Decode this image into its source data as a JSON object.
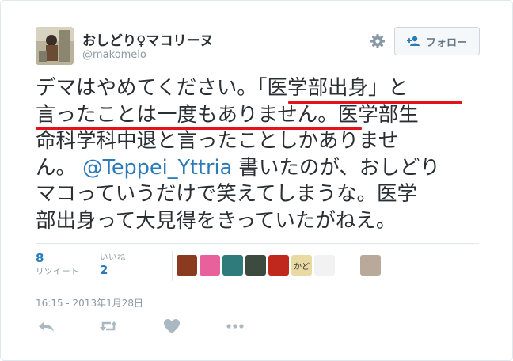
{
  "user": {
    "display_name": "おしどり♀マコリーヌ",
    "handle": "@makomelo"
  },
  "follow_button": {
    "label": "フォロー"
  },
  "tweet": {
    "lines": [
      [
        "デマはやめてください。",
        "「医学部出身」と"
      ],
      [
        "言ったことは一度もありません。",
        "医学部生"
      ],
      [
        "命科学科中退と言ったことしかありませ"
      ],
      [
        "ん。 ",
        "@Teppei_Yttria",
        " 書いたのが、おしどり"
      ],
      [
        "マコっていうだけで笑えてしまうな。医学"
      ],
      [
        "部出身って大見得をきっていたがねえ。"
      ]
    ]
  },
  "stats": {
    "retweets": {
      "count": "8",
      "label": "リツイート"
    },
    "likes": {
      "count": "2",
      "label": "いいね"
    }
  },
  "timestamp": "16:15 - 2013年1月28日",
  "likers": [
    {
      "name": "liker-avatar-1",
      "color": "#8a3b1f"
    },
    {
      "name": "liker-avatar-2",
      "color": "#e8609c"
    },
    {
      "name": "liker-avatar-3",
      "color": "#2f7a7a"
    },
    {
      "name": "liker-avatar-4",
      "color": "#3d4a3f"
    },
    {
      "name": "liker-avatar-5",
      "color": "#c0281d"
    },
    {
      "name": "liker-avatar-6",
      "color": "#e9d9a3",
      "text": "かど"
    },
    {
      "name": "liker-avatar-7",
      "color": "#f2f2f2"
    },
    {
      "name": "liker-avatar-8",
      "color": "#ffffff"
    },
    {
      "name": "liker-avatar-9",
      "color": "#b9a99a"
    },
    {
      "name": "liker-avatar-10",
      "color": "#ffffff"
    }
  ],
  "colors": {
    "link": "#2b7bb9",
    "text": "#292f33",
    "muted": "#8899a6",
    "underline": "#e5121c"
  },
  "icons": [
    "gear-icon",
    "follow-person-icon",
    "reply-icon",
    "retweet-icon",
    "like-heart-icon",
    "more-icon"
  ]
}
